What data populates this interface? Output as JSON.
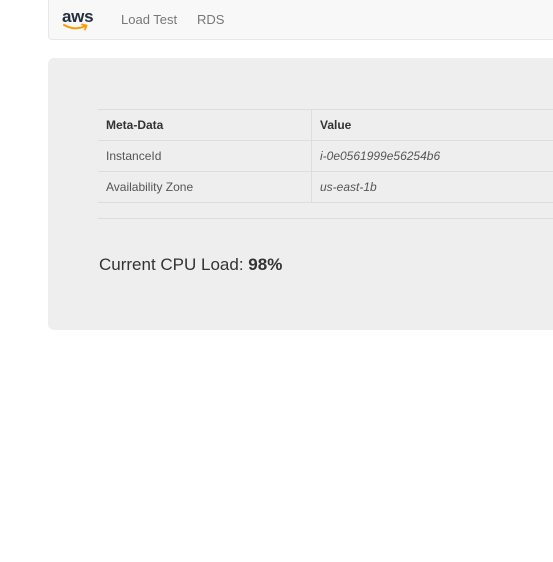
{
  "navbar": {
    "brand": "aws",
    "links": [
      "Load Test",
      "RDS"
    ]
  },
  "table": {
    "headers": [
      "Meta-Data",
      "Value"
    ],
    "rows": [
      [
        "InstanceId",
        "i-0e0561999e56254b6"
      ],
      [
        "Availability Zone",
        "us-east-1b"
      ]
    ]
  },
  "cpu": {
    "label": "Current CPU Load: ",
    "value": "98%"
  },
  "colors": {
    "brand_text": "#232f3e",
    "brand_smile": "#ff9900",
    "panel_bg": "#eeeeee",
    "navbar_bg": "#f8f8f8"
  }
}
